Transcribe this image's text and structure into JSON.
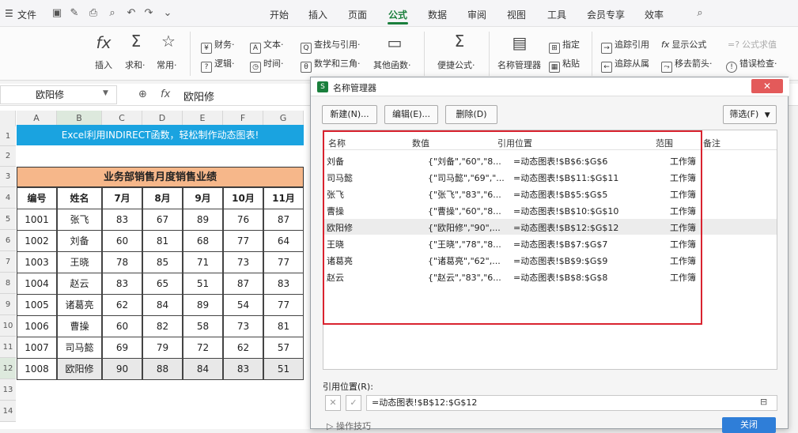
{
  "menubar": {
    "file_label": "文件",
    "tabs": [
      "开始",
      "插入",
      "页面",
      "公式",
      "数据",
      "审阅",
      "视图",
      "工具",
      "会员专享",
      "效率"
    ],
    "active_tab": "公式"
  },
  "ribbon": {
    "insert_fn": "插入",
    "sum": "求和·",
    "common": "常用·",
    "finance": "财务·",
    "text": "文本·",
    "lookup": "查找与引用·",
    "logic": "逻辑·",
    "time": "时间·",
    "math": "数学和三角·",
    "other": "其他函数·",
    "quick": "便捷公式·",
    "name_manager": "名称管理器",
    "specify": "指定",
    "paste": "粘贴",
    "trace_precedents": "追踪引用",
    "trace_dependents": "追踪从属",
    "show_formula": "显示公式",
    "remove_arrows": "移去箭头·",
    "formula_eval": "公式求值",
    "error_check": "错误检查·"
  },
  "formula_bar": {
    "name_box": "欧阳修",
    "value": "欧阳修"
  },
  "sheet": {
    "columns": [
      "A",
      "B",
      "C",
      "D",
      "E",
      "F",
      "G"
    ],
    "rows": [
      "1",
      "2",
      "3",
      "4",
      "5",
      "6",
      "7",
      "8",
      "9",
      "10",
      "11",
      "12",
      "13",
      "14"
    ],
    "banner": "Excel利用INDIRECT函数，轻松制作动态图表!",
    "table_title": "业务部销售月度销售业绩",
    "headers": [
      "编号",
      "姓名",
      "7月",
      "8月",
      "9月",
      "10月",
      "11月"
    ],
    "data": [
      [
        "1001",
        "张飞",
        "83",
        "67",
        "89",
        "76",
        "87"
      ],
      [
        "1002",
        "刘备",
        "60",
        "81",
        "68",
        "77",
        "64"
      ],
      [
        "1003",
        "王晓",
        "78",
        "85",
        "71",
        "73",
        "77"
      ],
      [
        "1004",
        "赵云",
        "83",
        "65",
        "51",
        "87",
        "83"
      ],
      [
        "1005",
        "诸葛亮",
        "62",
        "84",
        "89",
        "54",
        "77"
      ],
      [
        "1006",
        "曹操",
        "60",
        "82",
        "58",
        "73",
        "81"
      ],
      [
        "1007",
        "司马懿",
        "69",
        "79",
        "72",
        "62",
        "57"
      ],
      [
        "1008",
        "欧阳修",
        "90",
        "88",
        "84",
        "83",
        "51"
      ]
    ]
  },
  "dialog": {
    "title": "名称管理器",
    "close": "✕",
    "buttons": [
      "新建(N)...",
      "编辑(E)...",
      "删除(D)"
    ],
    "filter": "筛选(F)",
    "columns": [
      "名称",
      "数值",
      "引用位置",
      "范围",
      "备注"
    ],
    "rows": [
      {
        "name": "刘备",
        "value": "{\"刘备\",\"60\",\"8...",
        "ref": "=动态图表!$B$6:$G$6",
        "scope": "工作簿"
      },
      {
        "name": "司马懿",
        "value": "{\"司马懿\",\"69\",\"...",
        "ref": "=动态图表!$B$11:$G$11",
        "scope": "工作簿"
      },
      {
        "name": "张飞",
        "value": "{\"张飞\",\"83\",\"6...",
        "ref": "=动态图表!$B$5:$G$5",
        "scope": "工作簿"
      },
      {
        "name": "曹操",
        "value": "{\"曹操\",\"60\",\"8...",
        "ref": "=动态图表!$B$10:$G$10",
        "scope": "工作簿"
      },
      {
        "name": "欧阳修",
        "value": "{\"欧阳修\",\"90\",...",
        "ref": "=动态图表!$B$12:$G$12",
        "scope": "工作簿"
      },
      {
        "name": "王晓",
        "value": "{\"王晓\",\"78\",\"8...",
        "ref": "=动态图表!$B$7:$G$7",
        "scope": "工作簿"
      },
      {
        "name": "诸葛亮",
        "value": "{\"诸葛亮\",\"62\",...",
        "ref": "=动态图表!$B$9:$G$9",
        "scope": "工作簿"
      },
      {
        "name": "赵云",
        "value": "{\"赵云\",\"83\",\"6...",
        "ref": "=动态图表!$B$8:$G$8",
        "scope": "工作簿"
      }
    ],
    "ref_label": "引用位置(R):",
    "ref_value": "=动态图表!$B$12:$G$12",
    "ops_link": "操作技巧",
    "close_btn": "关闭"
  }
}
